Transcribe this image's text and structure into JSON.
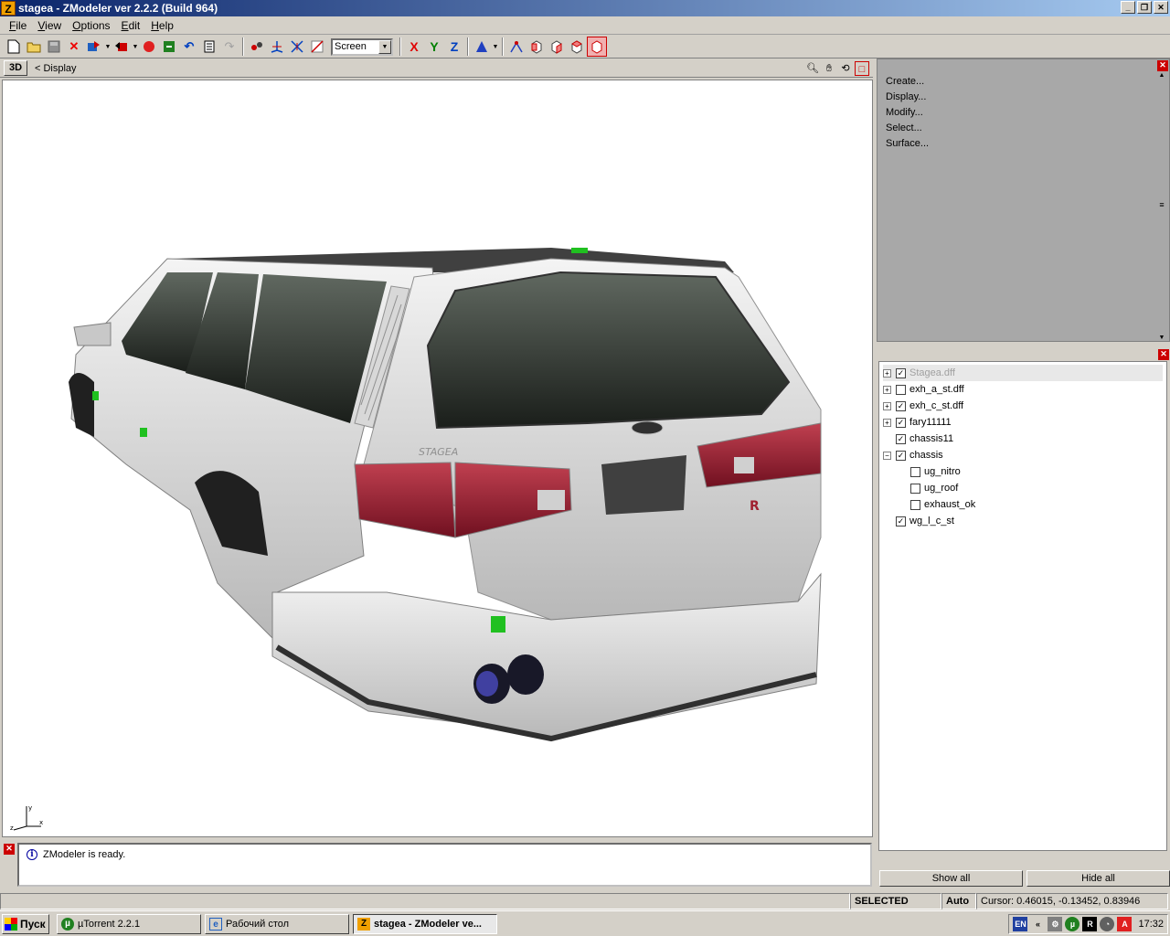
{
  "window": {
    "title": "stagea - ZModeler ver 2.2.2 (Build 964)",
    "app_icon": "Z"
  },
  "menu": [
    {
      "u": "F",
      "rest": "ile"
    },
    {
      "u": "V",
      "rest": "iew"
    },
    {
      "u": "O",
      "rest": "ptions"
    },
    {
      "u": "E",
      "rest": "dit"
    },
    {
      "u": "H",
      "rest": "elp"
    }
  ],
  "toolbar": {
    "coord_combo": "Screen",
    "axis_x": "X",
    "axis_y": "Y",
    "axis_z": "Z"
  },
  "viewport": {
    "mode_button": "3D",
    "breadcrumb": "<  Display",
    "car_badge": "STAGEA"
  },
  "log": {
    "message": "ZModeler is ready.",
    "info_glyph": "i"
  },
  "commands": [
    "Create...",
    "Display...",
    "Modify...",
    "Select...",
    "Surface..."
  ],
  "tree": {
    "items": [
      {
        "label": "Stagea.dff",
        "checked": true,
        "expander": "+",
        "indent": 0,
        "selected": true
      },
      {
        "label": "exh_a_st.dff",
        "checked": false,
        "expander": "+",
        "indent": 0
      },
      {
        "label": "exh_c_st.dff",
        "checked": true,
        "expander": "+",
        "indent": 0
      },
      {
        "label": "fary11111",
        "checked": true,
        "expander": "+",
        "indent": 0
      },
      {
        "label": "chassis11",
        "checked": true,
        "expander": "",
        "indent": 0
      },
      {
        "label": "chassis",
        "checked": true,
        "expander": "−",
        "indent": 0
      },
      {
        "label": "ug_nitro",
        "checked": false,
        "expander": "",
        "indent": 1
      },
      {
        "label": "ug_roof",
        "checked": false,
        "expander": "",
        "indent": 1
      },
      {
        "label": "exhaust_ok",
        "checked": false,
        "expander": "",
        "indent": 1
      },
      {
        "label": "wg_l_c_st",
        "checked": true,
        "expander": "",
        "indent": 0
      }
    ],
    "show_all": "Show all",
    "hide_all": "Hide all"
  },
  "status": {
    "mode": "SELECTED MODE",
    "auto": "Auto",
    "cursor": "Cursor: 0.46015, -0.13452, 0.83946"
  },
  "taskbar": {
    "start": "Пуск",
    "tasks": [
      {
        "label": "µTorrent 2.2.1",
        "icon": "µ"
      },
      {
        "label": "Рабочий стол",
        "icon": "e"
      },
      {
        "label": "stagea - ZModeler ve...",
        "icon": "Z"
      }
    ],
    "lang": "EN",
    "clock": "17:32"
  },
  "colors": {
    "titlebar_start": "#0a246a",
    "car_body": "#e0e0e0",
    "tail_light": "#a01830",
    "marker": "#20c020"
  }
}
